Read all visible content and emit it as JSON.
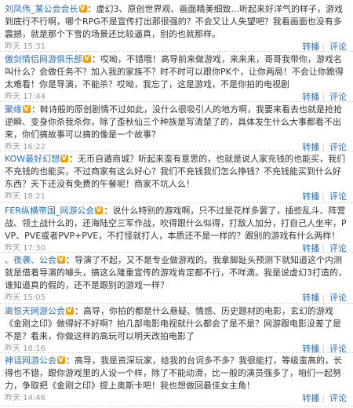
{
  "actions": {
    "repost": "转播",
    "sep": "|",
    "comment": "评论"
  },
  "posts": [
    {
      "author": "刘凤伟_某公会会长",
      "text": "：虚幻3、原创世界观、画面精美细致...听起来好洋气的样子，游戏到底行不行啊，哪个RPG不是宣传打出那很强的？不会又让人失望吧？我看画面也没有多震撼，就是那个下雪的场景还比较逼真，别的也就那样。",
      "time": "昨天 15:31"
    },
    {
      "author": "傲剑情侣网游俱乐部",
      "text": "：哎呦，不错哦！高导前来做游戏，来来来，哥哥我带你，游戏名叫什么？会做任务不？加入我的家族不？时不时可以跟你PK个，让你两局！不会让你跪得太难看！你是导演，不能杀？哎呦，我忘了，这是游戏，不是你拍的电视剧",
      "time": "昨天 17:44"
    },
    {
      "author": "聚缘",
      "text": "：斡诗般的原创剧情不过如此，没什么很吸引人的地方啊，我要来看去也就是抢抢逆瞬、变身你杀我杀你，除了歪秋仙三个种族是写清楚了的，具体发生什么大事都看不出来，你们搞故事可以搞的像是一个故事？",
      "time": "昨天 16:22"
    },
    {
      "author": "KOW最好幻想",
      "text": "：无币自遁商城？听起来蛮有意思的，也就是说人家充钱的也能买，我们不充钱的也能买，不过商家有这么好心？我们不充钱我们怎么挣钱？不充钱能买到什么好东西？天下还没有免费的午餐呢！商家不坑人么！",
      "time": "昨天 18:21"
    },
    {
      "author": "FER纵横帝国_网游公会",
      "text": "：说什么特别的游戏啊，只不过是花样多罢了，插些乱斗、阵营战、领土战什么的，还海陆空三军作战，吹得跟什么似得，打敌人加分，打自己人坐牢，PVP、PVE或者PVP+PVE，不打怪就打人，本质还不是一样的？跟别的游戏有什么两样！",
      "time": "昨天 17:30"
    },
    {
      "author": "、夜袭、公会",
      "text": "：导演了不起，又不是专业做游戏的。我拿脚趾头预测下就知道这个内测就是借着导演的噱头，搞这么隆重宣传的游戏肯定都不行，不咩滴。我是说虚幻3打造的，谁知道真的假的，还不是跟别的游戏一样？",
      "time": "昨天 15:05"
    },
    {
      "author": "离恨天网游公会",
      "text": "：高导，你拍的都是什么悬疑、情感、历史题材的电影，玄幻的游戏《金刚之印》做得好不好啊？拍几部电影电视就什么都会了是不是？网游跟电影没差了是不是？看来，你做这样的高玩可以明天改拍电影了",
      "time": "昨天 18:16"
    },
    {
      "author": "神话网游公会",
      "text": "：高导，我是资深玩家，给我的台词多不多？我很能打，等级蛮高的，长得也不错，跟你游戏里的人设一个样，除了不能动滑，比一般的演员强多了，咱们一起努力，争取把《金刚之印》提上奥斯卡吧！我也想做回最佳女主角！",
      "time": "昨天 14:46"
    }
  ]
}
